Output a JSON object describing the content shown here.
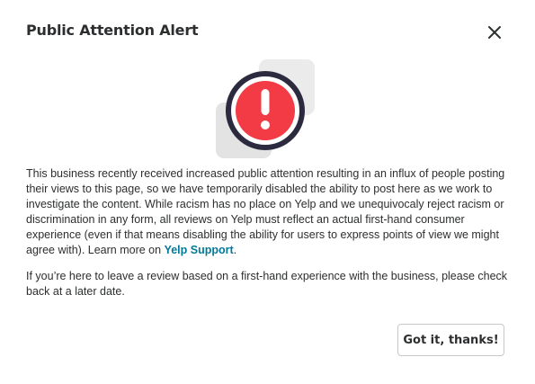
{
  "modal": {
    "title": "Public Attention Alert",
    "close_icon": "close-icon",
    "illustration_icon": "exclamation-alert-icon",
    "body": {
      "paragraph1_text": "This business recently received increased public attention resulting in an influx of people posting their views to this page, so we have temporarily disabled the ability to post here as we work to investigate the content. While racism has no place on Yelp and we unequivocaly reject racism or discrimination in any form, all reviews on Yelp must reflect an actual first-hand consumer experience (even if that means disabling the ability for users to express points of view we might agree with). Learn more on ",
      "support_link_label": "Yelp Support",
      "paragraph1_end": ".",
      "paragraph2_text": "If you’re here to leave a review based on a first-hand experience with the business, please check back at a later date."
    },
    "confirm_button_label": "Got it, thanks!"
  },
  "colors": {
    "alert_red": "#f23b45",
    "alert_ring": "#2b2a3f",
    "link_teal": "#027a97",
    "text": "#2d2e2f",
    "button_border": "#c8c9ca"
  }
}
